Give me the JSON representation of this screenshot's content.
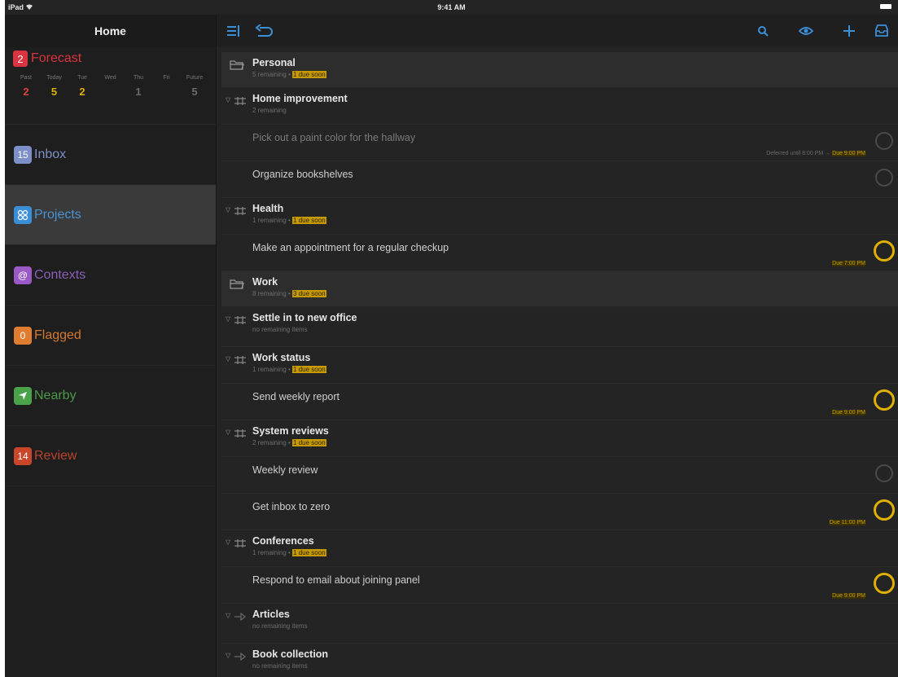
{
  "statusbar": {
    "device": "iPad",
    "time": "9:41 AM"
  },
  "sidebar": {
    "title": "Home",
    "forecast": {
      "label": "Forecast",
      "badge": "2",
      "color": "#d9343f",
      "days": [
        {
          "name": "Past",
          "count": "2",
          "color": "#e0433d"
        },
        {
          "name": "Today",
          "count": "5",
          "color": "#e0b000"
        },
        {
          "name": "Tue",
          "count": "2",
          "color": "#e0b000"
        },
        {
          "name": "Wed",
          "count": "",
          "color": "#555555"
        },
        {
          "name": "Thu",
          "count": "1",
          "color": "#6a6a6a"
        },
        {
          "name": "Fri",
          "count": "",
          "color": "#555555"
        },
        {
          "name": "Future",
          "count": "5",
          "color": "#6a6a6a"
        }
      ]
    },
    "items": [
      {
        "label": "Inbox",
        "badge": "15",
        "color": "#7d8fc9",
        "text_color": "#7e8fc4",
        "icon": "inbox-icon"
      },
      {
        "label": "Projects",
        "badge": "",
        "color": "#3b8fd9",
        "text_color": "#4a93d4",
        "icon": "projects-icon"
      },
      {
        "label": "Contexts",
        "badge": "@",
        "color": "#9b59c7",
        "text_color": "#8a5fb8",
        "icon": "contexts-icon"
      },
      {
        "label": "Flagged",
        "badge": "0",
        "color": "#e07c2f",
        "text_color": "#d4782e",
        "icon": "flag-icon"
      },
      {
        "label": "Nearby",
        "badge": "",
        "color": "#4aa34a",
        "text_color": "#4a9a45",
        "icon": "location-arrow-icon"
      },
      {
        "label": "Review",
        "badge": "14",
        "color": "#c9452c",
        "text_color": "#b8432c",
        "icon": "review-icon"
      }
    ]
  },
  "main": {
    "rows": [
      {
        "kind": "folder",
        "name": "Personal",
        "sub": "5 remaining • ",
        "due": "1 due soon"
      },
      {
        "kind": "project",
        "name": "Home improvement",
        "sub": "2 remaining",
        "due": ""
      },
      {
        "kind": "task",
        "name": "Pick out a paint color for the hallway",
        "dim": true,
        "meta": "Deferred until 8:00 PM → ",
        "meta_due": "Due 9:00 PM",
        "circle": "normal"
      },
      {
        "kind": "task",
        "name": "Organize bookshelves",
        "dim": false,
        "meta": "",
        "meta_due": "",
        "circle": "normal"
      },
      {
        "kind": "project",
        "name": "Health",
        "sub": "1 remaining • ",
        "due": "1 due soon"
      },
      {
        "kind": "task",
        "name": "Make an appointment for a regular checkup",
        "dim": false,
        "meta": "",
        "meta_due": "Due 7:00 PM",
        "circle": "due"
      },
      {
        "kind": "folder",
        "name": "Work",
        "sub": "8 remaining • ",
        "due": "3 due soon"
      },
      {
        "kind": "project",
        "name": "Settle in to new office",
        "sub": "no remaining items",
        "due": ""
      },
      {
        "kind": "project",
        "name": "Work status",
        "sub": "1 remaining • ",
        "due": "1 due soon"
      },
      {
        "kind": "task",
        "name": "Send weekly report",
        "dim": false,
        "meta": "",
        "meta_due": "Due 9:00 PM",
        "circle": "due"
      },
      {
        "kind": "project",
        "name": "System reviews",
        "sub": "2 remaining • ",
        "due": "1 due soon"
      },
      {
        "kind": "task",
        "name": "Weekly review",
        "dim": false,
        "meta": "",
        "meta_due": "",
        "circle": "normal"
      },
      {
        "kind": "task",
        "name": "Get inbox to zero",
        "dim": false,
        "meta": "",
        "meta_due": "Due 11:00 PM",
        "circle": "due"
      },
      {
        "kind": "project",
        "name": "Conferences",
        "sub": "1 remaining • ",
        "due": "1 due soon"
      },
      {
        "kind": "task",
        "name": "Respond to email about joining panel",
        "dim": false,
        "meta": "",
        "meta_due": "Due 9:00 PM",
        "circle": "due"
      },
      {
        "kind": "project",
        "name": "Articles",
        "sub": "no remaining items",
        "due": "",
        "single": true
      },
      {
        "kind": "project",
        "name": "Book collection",
        "sub": "no remaining items",
        "due": "",
        "single": true
      }
    ]
  },
  "colors": {
    "accent": "#3b8fd9",
    "due": "#e0b000"
  }
}
